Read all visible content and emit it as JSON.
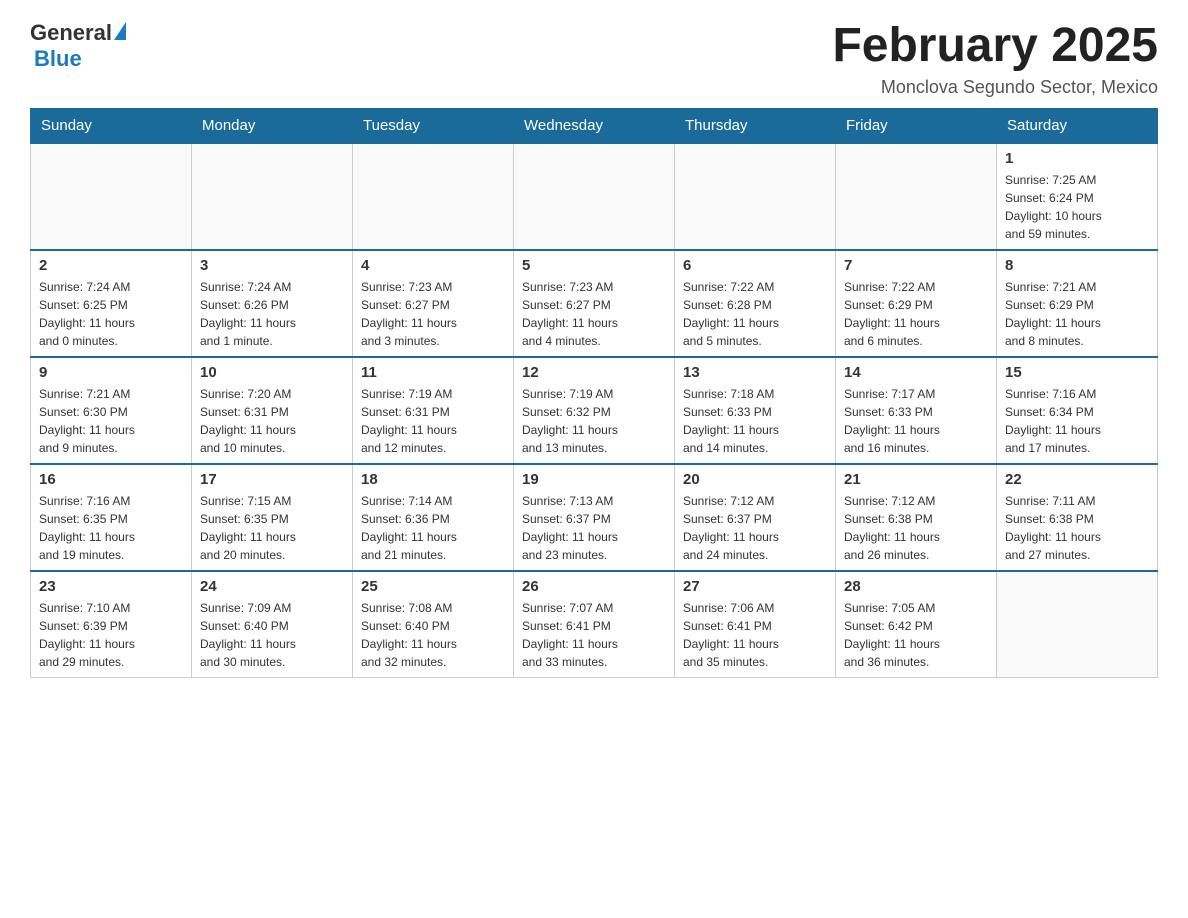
{
  "header": {
    "logo_general": "General",
    "logo_blue": "Blue",
    "month_year": "February 2025",
    "location": "Monclova Segundo Sector, Mexico"
  },
  "weekdays": [
    "Sunday",
    "Monday",
    "Tuesday",
    "Wednesday",
    "Thursday",
    "Friday",
    "Saturday"
  ],
  "weeks": [
    [
      {
        "day": "",
        "info": ""
      },
      {
        "day": "",
        "info": ""
      },
      {
        "day": "",
        "info": ""
      },
      {
        "day": "",
        "info": ""
      },
      {
        "day": "",
        "info": ""
      },
      {
        "day": "",
        "info": ""
      },
      {
        "day": "1",
        "info": "Sunrise: 7:25 AM\nSunset: 6:24 PM\nDaylight: 10 hours\nand 59 minutes."
      }
    ],
    [
      {
        "day": "2",
        "info": "Sunrise: 7:24 AM\nSunset: 6:25 PM\nDaylight: 11 hours\nand 0 minutes."
      },
      {
        "day": "3",
        "info": "Sunrise: 7:24 AM\nSunset: 6:26 PM\nDaylight: 11 hours\nand 1 minute."
      },
      {
        "day": "4",
        "info": "Sunrise: 7:23 AM\nSunset: 6:27 PM\nDaylight: 11 hours\nand 3 minutes."
      },
      {
        "day": "5",
        "info": "Sunrise: 7:23 AM\nSunset: 6:27 PM\nDaylight: 11 hours\nand 4 minutes."
      },
      {
        "day": "6",
        "info": "Sunrise: 7:22 AM\nSunset: 6:28 PM\nDaylight: 11 hours\nand 5 minutes."
      },
      {
        "day": "7",
        "info": "Sunrise: 7:22 AM\nSunset: 6:29 PM\nDaylight: 11 hours\nand 6 minutes."
      },
      {
        "day": "8",
        "info": "Sunrise: 7:21 AM\nSunset: 6:29 PM\nDaylight: 11 hours\nand 8 minutes."
      }
    ],
    [
      {
        "day": "9",
        "info": "Sunrise: 7:21 AM\nSunset: 6:30 PM\nDaylight: 11 hours\nand 9 minutes."
      },
      {
        "day": "10",
        "info": "Sunrise: 7:20 AM\nSunset: 6:31 PM\nDaylight: 11 hours\nand 10 minutes."
      },
      {
        "day": "11",
        "info": "Sunrise: 7:19 AM\nSunset: 6:31 PM\nDaylight: 11 hours\nand 12 minutes."
      },
      {
        "day": "12",
        "info": "Sunrise: 7:19 AM\nSunset: 6:32 PM\nDaylight: 11 hours\nand 13 minutes."
      },
      {
        "day": "13",
        "info": "Sunrise: 7:18 AM\nSunset: 6:33 PM\nDaylight: 11 hours\nand 14 minutes."
      },
      {
        "day": "14",
        "info": "Sunrise: 7:17 AM\nSunset: 6:33 PM\nDaylight: 11 hours\nand 16 minutes."
      },
      {
        "day": "15",
        "info": "Sunrise: 7:16 AM\nSunset: 6:34 PM\nDaylight: 11 hours\nand 17 minutes."
      }
    ],
    [
      {
        "day": "16",
        "info": "Sunrise: 7:16 AM\nSunset: 6:35 PM\nDaylight: 11 hours\nand 19 minutes."
      },
      {
        "day": "17",
        "info": "Sunrise: 7:15 AM\nSunset: 6:35 PM\nDaylight: 11 hours\nand 20 minutes."
      },
      {
        "day": "18",
        "info": "Sunrise: 7:14 AM\nSunset: 6:36 PM\nDaylight: 11 hours\nand 21 minutes."
      },
      {
        "day": "19",
        "info": "Sunrise: 7:13 AM\nSunset: 6:37 PM\nDaylight: 11 hours\nand 23 minutes."
      },
      {
        "day": "20",
        "info": "Sunrise: 7:12 AM\nSunset: 6:37 PM\nDaylight: 11 hours\nand 24 minutes."
      },
      {
        "day": "21",
        "info": "Sunrise: 7:12 AM\nSunset: 6:38 PM\nDaylight: 11 hours\nand 26 minutes."
      },
      {
        "day": "22",
        "info": "Sunrise: 7:11 AM\nSunset: 6:38 PM\nDaylight: 11 hours\nand 27 minutes."
      }
    ],
    [
      {
        "day": "23",
        "info": "Sunrise: 7:10 AM\nSunset: 6:39 PM\nDaylight: 11 hours\nand 29 minutes."
      },
      {
        "day": "24",
        "info": "Sunrise: 7:09 AM\nSunset: 6:40 PM\nDaylight: 11 hours\nand 30 minutes."
      },
      {
        "day": "25",
        "info": "Sunrise: 7:08 AM\nSunset: 6:40 PM\nDaylight: 11 hours\nand 32 minutes."
      },
      {
        "day": "26",
        "info": "Sunrise: 7:07 AM\nSunset: 6:41 PM\nDaylight: 11 hours\nand 33 minutes."
      },
      {
        "day": "27",
        "info": "Sunrise: 7:06 AM\nSunset: 6:41 PM\nDaylight: 11 hours\nand 35 minutes."
      },
      {
        "day": "28",
        "info": "Sunrise: 7:05 AM\nSunset: 6:42 PM\nDaylight: 11 hours\nand 36 minutes."
      },
      {
        "day": "",
        "info": ""
      }
    ]
  ]
}
